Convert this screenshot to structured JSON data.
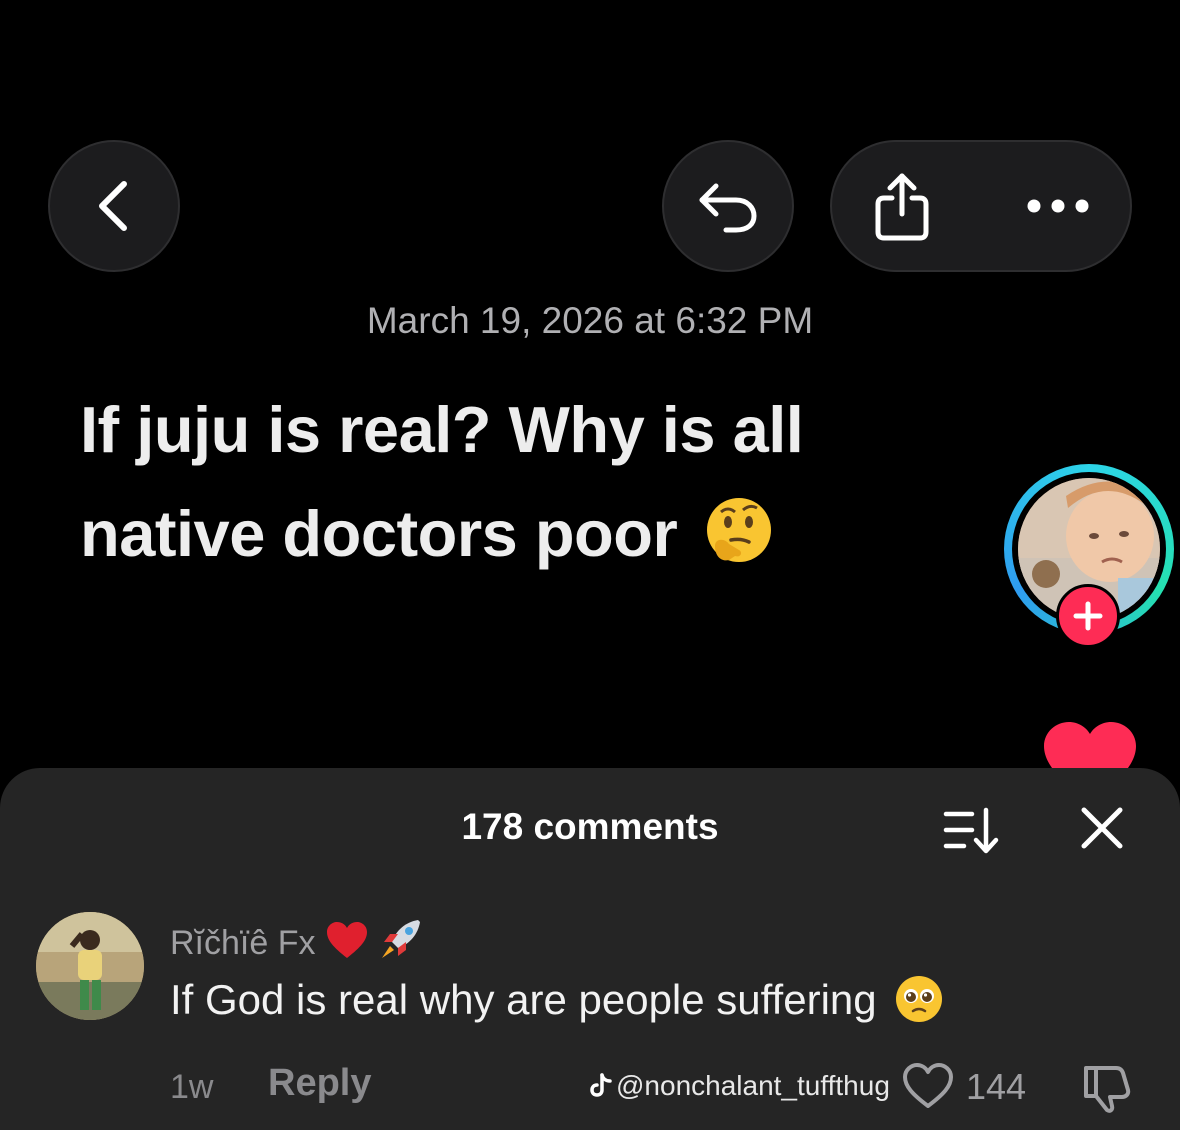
{
  "header": {
    "back_icon": "chevron-left-icon",
    "undo_icon": "undo-arrow-icon",
    "share_icon": "share-icon",
    "more_icon": "more-horizontal-icon"
  },
  "post": {
    "date": "March 19, 2026 at 6:32 PM",
    "text": "If juju is real? Why is all native doctors poor",
    "emoji": "thinking-face-emoji"
  },
  "sidebar": {
    "follow_label": "+",
    "ring_colors": [
      "#2dd4e8",
      "#25e0b0",
      "#2f9cf0"
    ],
    "follow_color": "#fe2c55",
    "like_color": "#fe2c55"
  },
  "comments": {
    "count_label": "178 comments",
    "items": [
      {
        "username": "Rĭčhïê Fx",
        "text": "If God is real why are people suffering",
        "time": "1w",
        "reply_label": "Reply",
        "likes": "144"
      }
    ]
  },
  "watermark": {
    "handle": "@nonchalant_tuffthug"
  }
}
